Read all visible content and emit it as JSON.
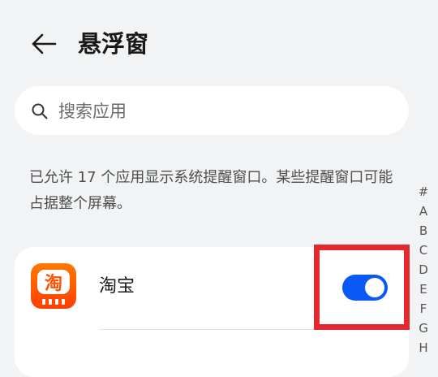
{
  "header": {
    "title": "悬浮窗",
    "back_icon": "arrow-left-icon"
  },
  "search": {
    "placeholder": "搜索应用",
    "value": "",
    "icon": "search-icon"
  },
  "description": "已允许 17 个应用显示系统提醒窗口。某些提醒窗口可能占据整个屏幕。",
  "index_letters": [
    "#",
    "A",
    "B",
    "C",
    "D",
    "E",
    "F",
    "G",
    "H"
  ],
  "apps": [
    {
      "name": "淘宝",
      "enabled": true,
      "icon_glyph": "淘",
      "icon_color": "#ff5000"
    }
  ],
  "colors": {
    "accent": "#0a59f7",
    "highlight": "#e5282e",
    "background": "#f1f3f5"
  }
}
